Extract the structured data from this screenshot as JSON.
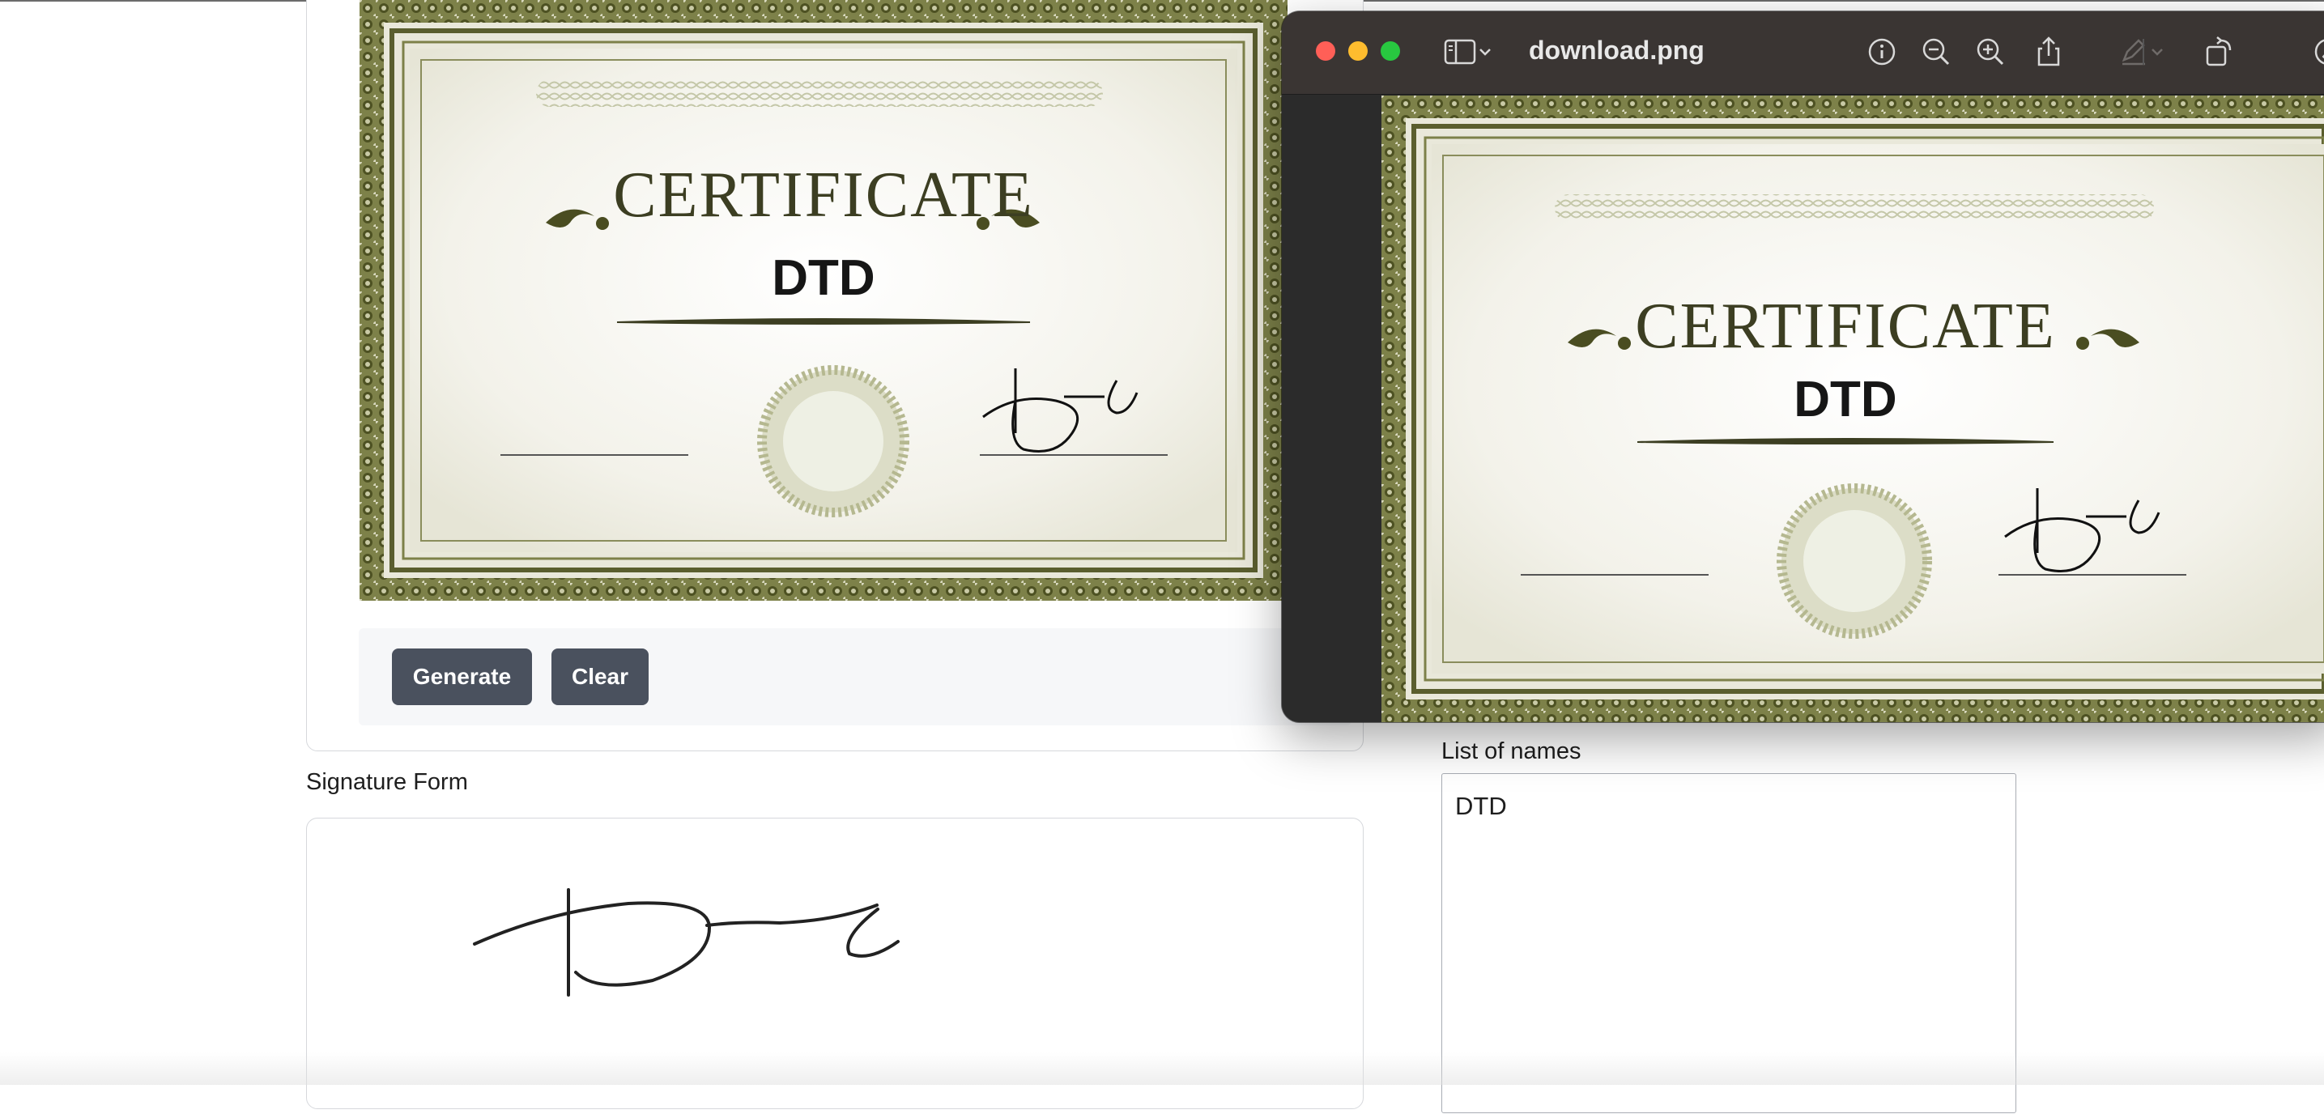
{
  "page": {
    "generate_label": "Generate",
    "clear_label": "Clear",
    "signature_form_label": "Signature Form",
    "names_label": "List of names",
    "names_value": "DTD"
  },
  "certificate": {
    "title": "CERTIFICATE",
    "recipient": "DTD"
  },
  "viewer": {
    "window_title": "download.png",
    "toolbar_icons": [
      "sidebar-icon",
      "chevron-down-icon",
      "info-icon",
      "zoom-out-icon",
      "zoom-in-icon",
      "share-icon",
      "markup-icon",
      "chevron-down-icon",
      "rotate-icon",
      "more-icon"
    ]
  },
  "colors": {
    "button_bg": "#4a515e",
    "border_green": "#5a5e2e",
    "viewer_titlebar": "#3a3533"
  }
}
